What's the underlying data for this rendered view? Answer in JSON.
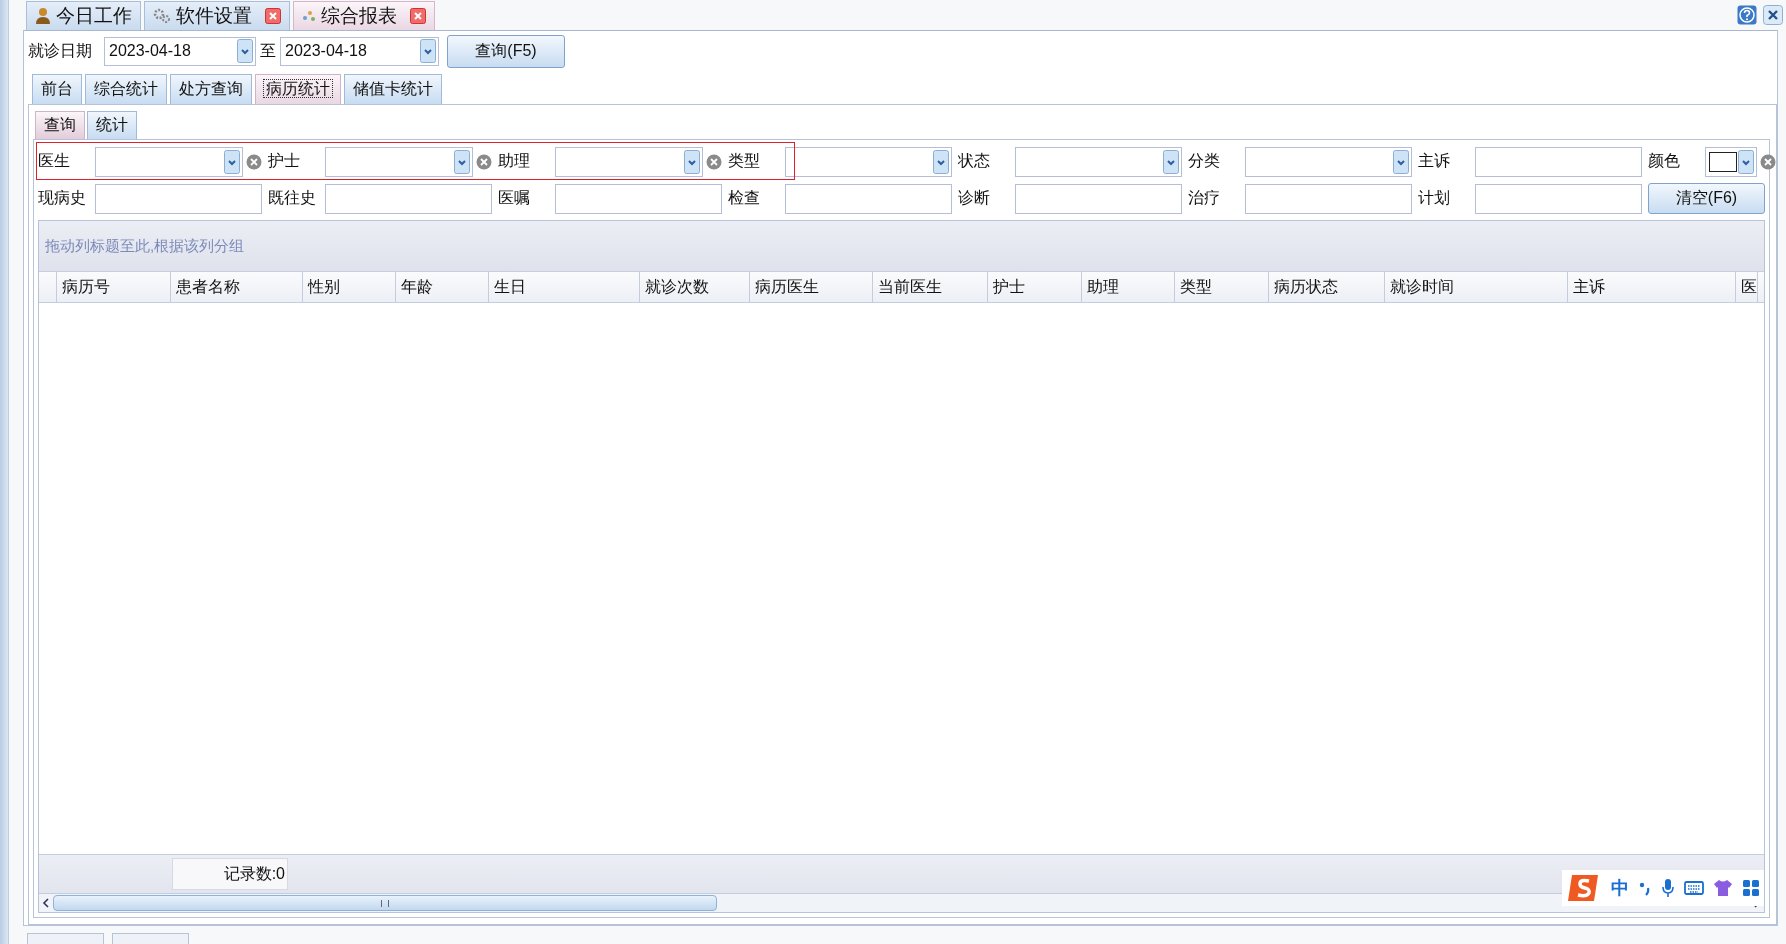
{
  "top_tabs": [
    {
      "label": "今日工作",
      "closable": false,
      "selected": false
    },
    {
      "label": "软件设置",
      "closable": true,
      "selected": false
    },
    {
      "label": "综合报表",
      "closable": true,
      "selected": true
    }
  ],
  "date_filter": {
    "label": "就诊日期",
    "from": "2023-04-18",
    "separator": "至",
    "to": "2023-04-18",
    "query_button": "查询(F5)"
  },
  "section_tabs": [
    {
      "label": "前台",
      "selected": false
    },
    {
      "label": "综合统计",
      "selected": false
    },
    {
      "label": "处方查询",
      "selected": false
    },
    {
      "label": "病历统计",
      "selected": true
    },
    {
      "label": "储值卡统计",
      "selected": false
    }
  ],
  "inner_tabs": [
    {
      "label": "查询",
      "selected": true
    },
    {
      "label": "统计",
      "selected": false
    }
  ],
  "filters": [
    {
      "label": "医生",
      "kind": "clearable_combo"
    },
    {
      "label": "护士",
      "kind": "clearable_combo"
    },
    {
      "label": "助理",
      "kind": "clearable_combo"
    },
    {
      "label": "类型",
      "kind": "combo"
    },
    {
      "label": "状态",
      "kind": "combo"
    },
    {
      "label": "分类",
      "kind": "combo"
    },
    {
      "label": "主诉",
      "kind": "text"
    },
    {
      "label": "颜色",
      "kind": "color"
    },
    {
      "label": "现病史",
      "kind": "text"
    },
    {
      "label": "既往史",
      "kind": "text"
    },
    {
      "label": "医嘱",
      "kind": "text"
    },
    {
      "label": "检查",
      "kind": "text"
    },
    {
      "label": "诊断",
      "kind": "text"
    },
    {
      "label": "治疗",
      "kind": "text"
    },
    {
      "label": "计划",
      "kind": "text"
    }
  ],
  "clear_button": "清空(F6)",
  "group_panel_hint": "拖动列标题至此,根据该列分组",
  "table": {
    "columns": [
      "病历号",
      "患者名称",
      "性别",
      "年龄",
      "生日",
      "就诊次数",
      "病历医生",
      "当前医生",
      "护士",
      "助理",
      "类型",
      "病历状态",
      "就诊时间",
      "主诉",
      "医"
    ]
  },
  "footer": {
    "record_count": "记录数:0"
  },
  "ime_toolbar": {
    "mode": "中"
  }
}
